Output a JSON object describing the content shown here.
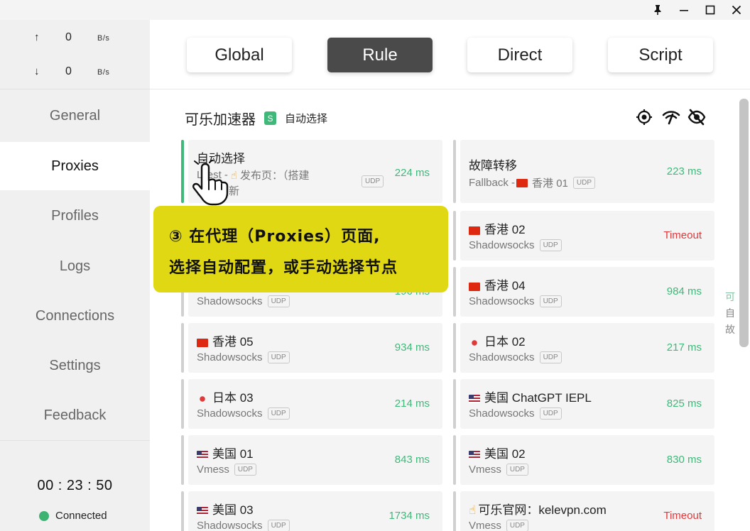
{
  "window": {
    "pin_icon": "pin-icon",
    "minimize_icon": "minimize-icon",
    "maximize_icon": "maximize-icon",
    "close_icon": "close-icon"
  },
  "traffic": {
    "up_arrow": "↑",
    "up_value": "0",
    "up_unit": "B/s",
    "down_arrow": "↓",
    "down_value": "0",
    "down_unit": "B/s"
  },
  "nav": {
    "general": "General",
    "proxies": "Proxies",
    "profiles": "Profiles",
    "logs": "Logs",
    "connections": "Connections",
    "settings": "Settings",
    "feedback": "Feedback"
  },
  "status": {
    "clock": "00 : 23 : 50",
    "connection": "Connected",
    "connected_color": "#3cb371"
  },
  "modes": {
    "global": "Global",
    "rule": "Rule",
    "direct": "Direct",
    "script": "Script",
    "active": "Rule"
  },
  "group": {
    "title": "可乐加速器",
    "badge": "S",
    "current": "自动选择",
    "icons": [
      "locate-icon",
      "wifi-speed-icon",
      "eye-off-icon"
    ]
  },
  "proxies": {
    "p0": {
      "name": "自动选择",
      "sub_prefix": "LTest - ",
      "sub_rest": "发布页：（搭建",
      "sub_line2": "注意更新",
      "udp": "UDP",
      "delay": "224 ms"
    },
    "p1": {
      "name": "故障转移",
      "sub": "Fallback - ",
      "sub_flag_name": "香港 01",
      "udp": "UDP",
      "delay": "223 ms"
    },
    "p2": {
      "name": "香港 02",
      "type": "Shadowsocks",
      "udp": "UDP",
      "delay": "Timeout"
    },
    "p3": {
      "type": "Shadowsocks",
      "udp": "UDP",
      "delay": "196 ms"
    },
    "p4": {
      "name": "香港 04",
      "type": "Shadowsocks",
      "udp": "UDP",
      "delay": "984 ms"
    },
    "p5": {
      "name": "香港 05",
      "type": "Shadowsocks",
      "udp": "UDP",
      "delay": "934 ms"
    },
    "p6": {
      "name": "日本 02",
      "type": "Shadowsocks",
      "udp": "UDP",
      "delay": "217 ms"
    },
    "p7": {
      "name": "日本 03",
      "type": "Shadowsocks",
      "udp": "UDP",
      "delay": "214 ms"
    },
    "p8": {
      "name": "美国 ChatGPT IEPL",
      "type": "Shadowsocks",
      "udp": "UDP",
      "delay": "825 ms"
    },
    "p9": {
      "name": "美国 01",
      "type": "Vmess",
      "udp": "UDP",
      "delay": "843 ms"
    },
    "p10": {
      "name": "美国 02",
      "type": "Vmess",
      "udp": "UDP",
      "delay": "830 ms"
    },
    "p11": {
      "name": "美国 03",
      "type": "Shadowsocks",
      "udp": "UDP",
      "delay": "1734 ms"
    },
    "p12": {
      "name": "可乐官网：kelevpn.com",
      "type": "Vmess",
      "udp": "UDP",
      "delay": "Timeout"
    }
  },
  "callout": {
    "line1": "③ 在代理（Proxies）页面,",
    "line2": "选择自动配置，或手动选择节点"
  },
  "side_peek": [
    "可",
    "自",
    "故"
  ],
  "colors": {
    "accent": "#3fb87a",
    "timeout": "#e0393b",
    "callout": "#e0d812"
  }
}
